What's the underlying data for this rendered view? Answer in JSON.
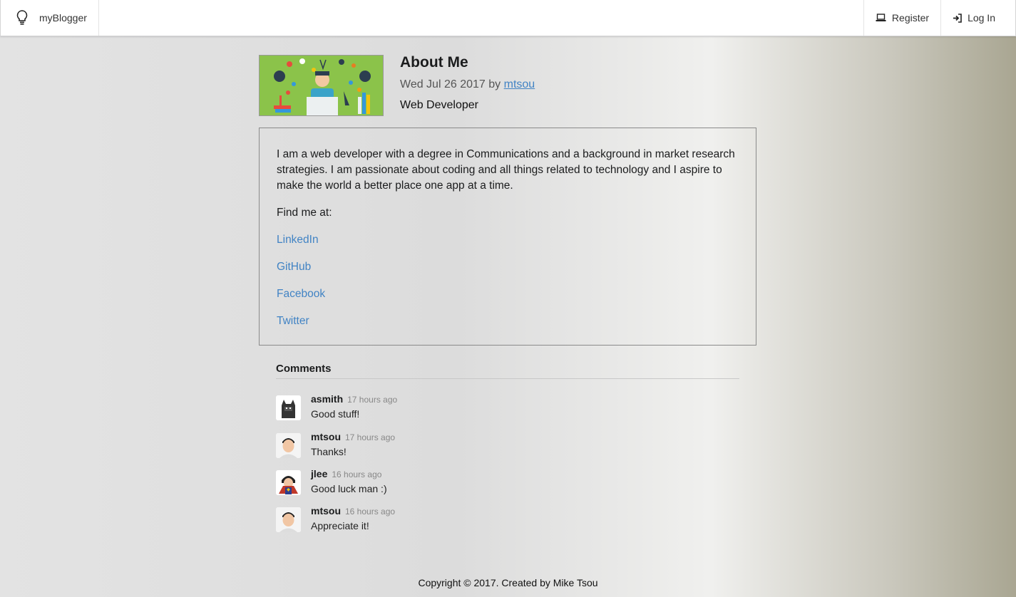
{
  "nav": {
    "brand": "myBlogger",
    "register": "Register",
    "login": "Log In"
  },
  "post": {
    "title": "About Me",
    "date": "Wed Jul 26 2017",
    "by": "by",
    "author": "mtsou",
    "subtitle": "Web Developer",
    "paragraph": "I am a web developer with a degree in Communications and a background in market research strategies. I am passionate about coding and all things related to technology and I aspire to make the world a better place one app at a time.",
    "find_me": "Find me at:",
    "links": [
      "LinkedIn",
      "GitHub",
      "Facebook",
      "Twitter"
    ]
  },
  "comments": {
    "header": "Comments",
    "items": [
      {
        "author": "asmith",
        "time": "17 hours ago",
        "text": "Good stuff!",
        "avatar": "batman-avatar"
      },
      {
        "author": "mtsou",
        "time": "17 hours ago",
        "text": "Thanks!",
        "avatar": "person-avatar"
      },
      {
        "author": "jlee",
        "time": "16 hours ago",
        "text": "Good luck man :)",
        "avatar": "superhero-avatar"
      },
      {
        "author": "mtsou",
        "time": "16 hours ago",
        "text": "Appreciate it!",
        "avatar": "person-avatar"
      }
    ]
  },
  "footer": "Copyright © 2017. Created by Mike Tsou",
  "colors": {
    "link": "#4183c4",
    "thumb_bg": "#8bc34a"
  }
}
